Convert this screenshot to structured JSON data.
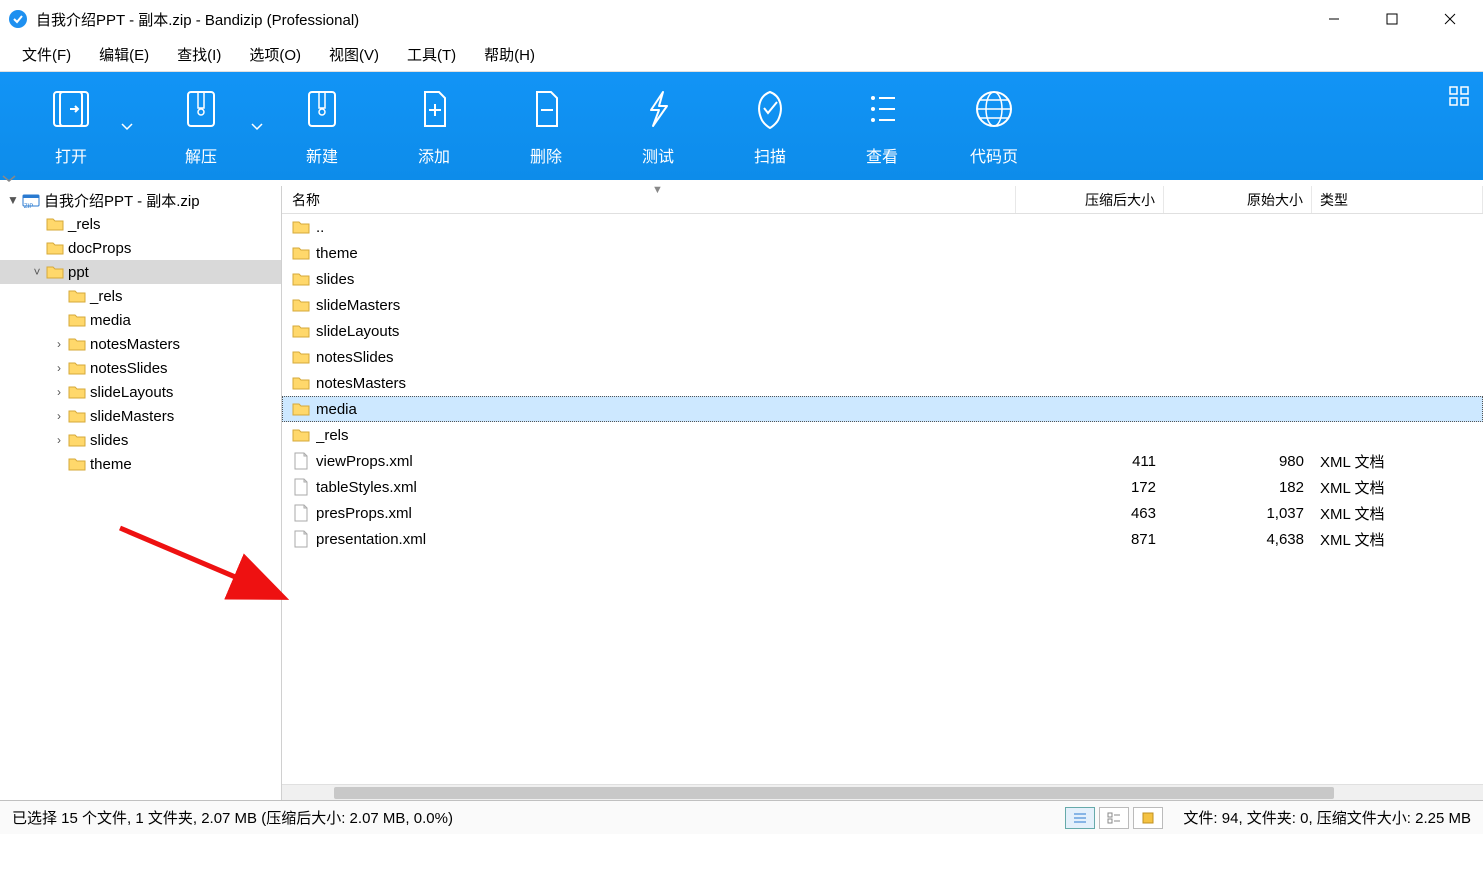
{
  "window": {
    "title": "自我介绍PPT - 副本.zip - Bandizip (Professional)"
  },
  "menubar": [
    "文件(F)",
    "编辑(E)",
    "查找(I)",
    "选项(O)",
    "视图(V)",
    "工具(T)",
    "帮助(H)"
  ],
  "toolbar": {
    "open": "打开",
    "extract": "解压",
    "new": "新建",
    "add": "添加",
    "delete": "删除",
    "test": "测试",
    "scan": "扫描",
    "view": "查看",
    "codepage": "代码页"
  },
  "tree": {
    "root": "自我介绍PPT - 副本.zip",
    "items": [
      {
        "depth": 1,
        "label": "_rels",
        "exp": ""
      },
      {
        "depth": 1,
        "label": "docProps",
        "exp": ""
      },
      {
        "depth": 1,
        "label": "ppt",
        "exp": "▼",
        "selected": true
      },
      {
        "depth": 2,
        "label": "_rels",
        "exp": ""
      },
      {
        "depth": 2,
        "label": "media",
        "exp": ""
      },
      {
        "depth": 2,
        "label": "notesMasters",
        "exp": "▶"
      },
      {
        "depth": 2,
        "label": "notesSlides",
        "exp": "▶"
      },
      {
        "depth": 2,
        "label": "slideLayouts",
        "exp": "▶"
      },
      {
        "depth": 2,
        "label": "slideMasters",
        "exp": "▶"
      },
      {
        "depth": 2,
        "label": "slides",
        "exp": "▶"
      },
      {
        "depth": 2,
        "label": "theme",
        "exp": ""
      }
    ]
  },
  "columns": {
    "name": "名称",
    "compressed": "压缩后大小",
    "original": "原始大小",
    "type": "类型"
  },
  "rows": [
    {
      "icon": "folder",
      "name": "..",
      "comp": "",
      "orig": "",
      "type": ""
    },
    {
      "icon": "folder",
      "name": "theme",
      "comp": "",
      "orig": "",
      "type": ""
    },
    {
      "icon": "folder",
      "name": "slides",
      "comp": "",
      "orig": "",
      "type": ""
    },
    {
      "icon": "folder",
      "name": "slideMasters",
      "comp": "",
      "orig": "",
      "type": ""
    },
    {
      "icon": "folder",
      "name": "slideLayouts",
      "comp": "",
      "orig": "",
      "type": ""
    },
    {
      "icon": "folder",
      "name": "notesSlides",
      "comp": "",
      "orig": "",
      "type": ""
    },
    {
      "icon": "folder",
      "name": "notesMasters",
      "comp": "",
      "orig": "",
      "type": ""
    },
    {
      "icon": "folder",
      "name": "media",
      "comp": "",
      "orig": "",
      "type": "",
      "selected": true
    },
    {
      "icon": "folder",
      "name": "_rels",
      "comp": "",
      "orig": "",
      "type": ""
    },
    {
      "icon": "file",
      "name": "viewProps.xml",
      "comp": "411",
      "orig": "980",
      "type": "XML 文档"
    },
    {
      "icon": "file",
      "name": "tableStyles.xml",
      "comp": "172",
      "orig": "182",
      "type": "XML 文档"
    },
    {
      "icon": "file",
      "name": "presProps.xml",
      "comp": "463",
      "orig": "1,037",
      "type": "XML 文档"
    },
    {
      "icon": "file",
      "name": "presentation.xml",
      "comp": "871",
      "orig": "4,638",
      "type": "XML 文档"
    }
  ],
  "statusbar": {
    "left": "已选择 15 个文件, 1 文件夹, 2.07 MB (压缩后大小: 2.07 MB, 0.0%)",
    "right": "文件: 94, 文件夹: 0, 压缩文件大小: 2.25 MB"
  }
}
